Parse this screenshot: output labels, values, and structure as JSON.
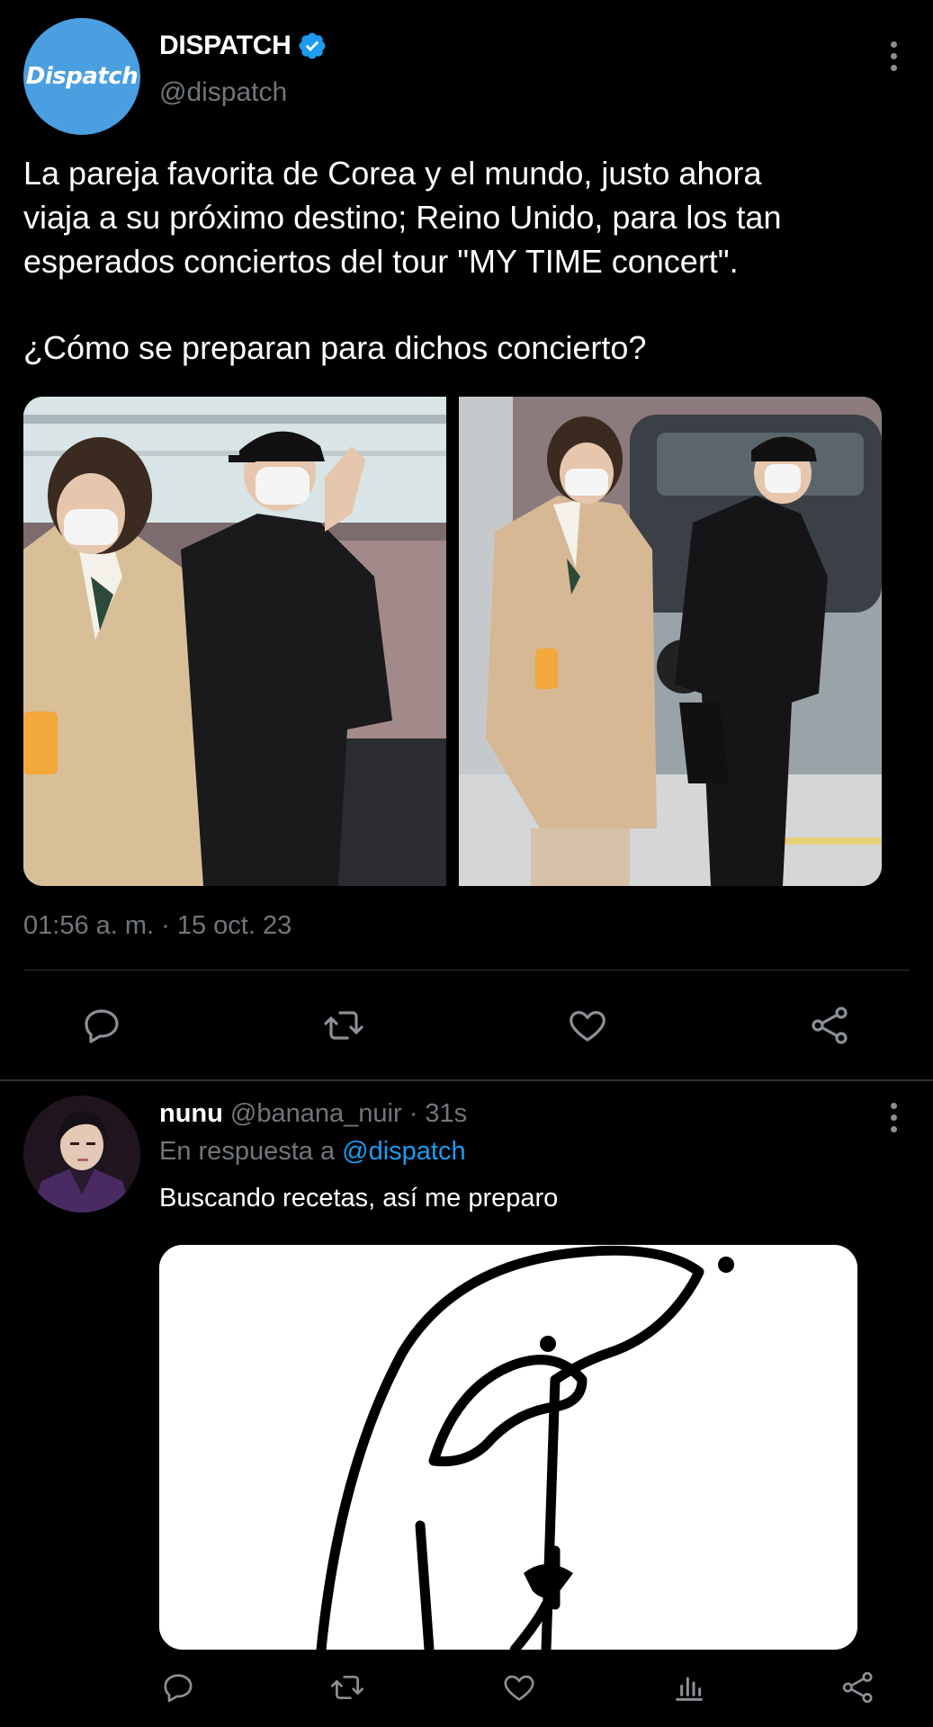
{
  "tweet": {
    "display_name": "DISPATCH",
    "handle": "@dispatch",
    "avatar_text": "Dispatch",
    "text_lines": [
      "La pareja favorita de Corea y el mundo, justo ahora",
      "viaja a su próximo destino; Reino Unido, para los tan",
      "esperados conciertos del tour \"MY TIME concert\"."
    ],
    "text_question": "¿Cómo se preparan para dichos concierto?",
    "timestamp": "01:56 a. m. · 15 oct. 23",
    "actions": [
      "reply-icon",
      "retweet-icon",
      "like-icon",
      "share-icon"
    ]
  },
  "reply": {
    "display_name": "nunu",
    "handle": "@banana_nuir",
    "separator": "·",
    "time": "31s",
    "in_reply_prefix": "En respuesta a",
    "in_reply_mention": "@dispatch",
    "text": "Buscando recetas, así me preparo",
    "actions": [
      "reply-icon",
      "retweet-icon",
      "like-icon",
      "views-icon",
      "share-icon"
    ]
  },
  "colors": {
    "background": "#000000",
    "text": "#ffffff",
    "secondary": "#71767b",
    "accent": "#1d9bf0",
    "avatar": "#4a9fe0"
  }
}
